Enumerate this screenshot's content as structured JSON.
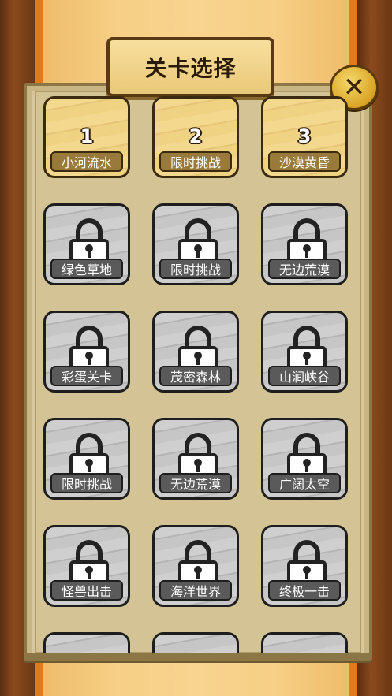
{
  "title": "关卡选择",
  "close_glyph": "✕",
  "levels": [
    {
      "number": "1",
      "name": "小河流水",
      "locked": false
    },
    {
      "number": "2",
      "name": "限时挑战",
      "locked": false
    },
    {
      "number": "3",
      "name": "沙漠黄昏",
      "locked": false
    },
    {
      "name": "绿色草地",
      "locked": true
    },
    {
      "name": "限时挑战",
      "locked": true
    },
    {
      "name": "无边荒漠",
      "locked": true
    },
    {
      "name": "彩蛋关卡",
      "locked": true
    },
    {
      "name": "茂密森林",
      "locked": true
    },
    {
      "name": "山涧峡谷",
      "locked": true
    },
    {
      "name": "限时挑战",
      "locked": true
    },
    {
      "name": "无边荒漠",
      "locked": true
    },
    {
      "name": "广阔太空",
      "locked": true
    },
    {
      "name": "怪兽出击",
      "locked": true
    },
    {
      "name": "海洋世界",
      "locked": true
    },
    {
      "name": "终极一击",
      "locked": true
    }
  ],
  "icons": {
    "lock": "lock-icon",
    "close": "close-icon"
  },
  "colors": {
    "wood": "#8b4a1d",
    "panel": "#d8c79c",
    "tile_unlocked": "#f3d88e",
    "tile_locked": "#cfcfcf"
  }
}
